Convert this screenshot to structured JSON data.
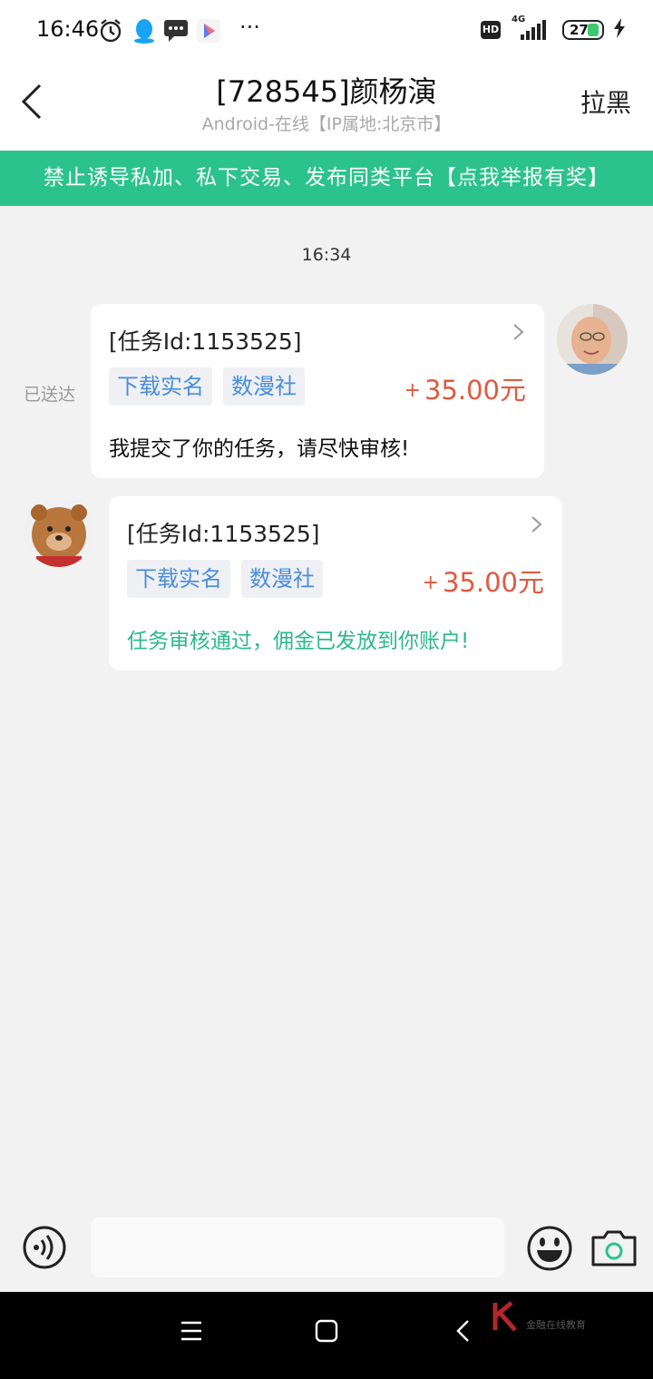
{
  "status_bar": {
    "time": "16:46",
    "more": "···",
    "hd": "HD",
    "network": "4G",
    "battery": "27"
  },
  "header": {
    "title": "[728545]颜杨演",
    "subtitle": "Android-在线【IP属地:北京市】",
    "block_label": "拉黑"
  },
  "banner": {
    "text": "禁止诱导私加、私下交易、发布同类平台【点我举报有奖】"
  },
  "chat": {
    "timestamp": "16:34",
    "messages": [
      {
        "side": "right",
        "task_id": "[任务Id:1153525]",
        "tags": [
          "下载实名",
          "数漫社"
        ],
        "reward_sign": "+",
        "reward": "35.00元",
        "text": "我提交了你的任务，请尽快审核!",
        "status": "已送达"
      },
      {
        "side": "left",
        "task_id": "[任务Id:1153525]",
        "tags": [
          "下载实名",
          "数漫社"
        ],
        "reward_sign": "+",
        "reward": "35.00元",
        "text": "任务审核通过，佣金已发放到你账户!"
      }
    ]
  },
  "input_bar": {
    "placeholder": ""
  },
  "watermark": {
    "text": "金融在线教育"
  },
  "colors": {
    "accent_green": "#2cc28e",
    "reward_red": "#e05a40",
    "tag_blue": "#4a8ddb"
  },
  "icons": {
    "back": "chevron-left-icon",
    "voice": "voice-icon",
    "emoji": "emoji-icon",
    "camera": "camera-icon"
  }
}
